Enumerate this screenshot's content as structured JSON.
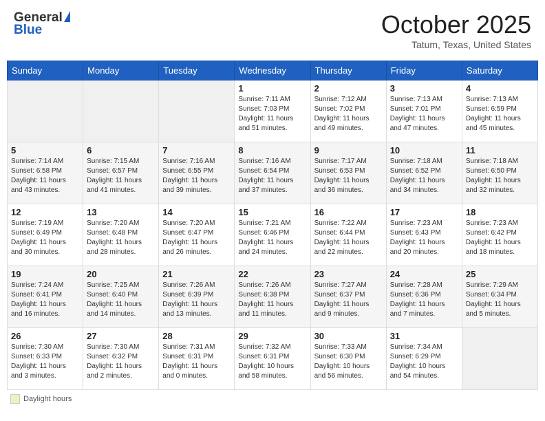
{
  "header": {
    "logo_general": "General",
    "logo_blue": "Blue",
    "month_title": "October 2025",
    "location": "Tatum, Texas, United States"
  },
  "weekdays": [
    "Sunday",
    "Monday",
    "Tuesday",
    "Wednesday",
    "Thursday",
    "Friday",
    "Saturday"
  ],
  "footer": {
    "legend_label": "Daylight hours"
  },
  "weeks": [
    [
      {
        "day": "",
        "sunrise": "",
        "sunset": "",
        "daylight": ""
      },
      {
        "day": "",
        "sunrise": "",
        "sunset": "",
        "daylight": ""
      },
      {
        "day": "",
        "sunrise": "",
        "sunset": "",
        "daylight": ""
      },
      {
        "day": "1",
        "sunrise": "Sunrise: 7:11 AM",
        "sunset": "Sunset: 7:03 PM",
        "daylight": "Daylight: 11 hours and 51 minutes."
      },
      {
        "day": "2",
        "sunrise": "Sunrise: 7:12 AM",
        "sunset": "Sunset: 7:02 PM",
        "daylight": "Daylight: 11 hours and 49 minutes."
      },
      {
        "day": "3",
        "sunrise": "Sunrise: 7:13 AM",
        "sunset": "Sunset: 7:01 PM",
        "daylight": "Daylight: 11 hours and 47 minutes."
      },
      {
        "day": "4",
        "sunrise": "Sunrise: 7:13 AM",
        "sunset": "Sunset: 6:59 PM",
        "daylight": "Daylight: 11 hours and 45 minutes."
      }
    ],
    [
      {
        "day": "5",
        "sunrise": "Sunrise: 7:14 AM",
        "sunset": "Sunset: 6:58 PM",
        "daylight": "Daylight: 11 hours and 43 minutes."
      },
      {
        "day": "6",
        "sunrise": "Sunrise: 7:15 AM",
        "sunset": "Sunset: 6:57 PM",
        "daylight": "Daylight: 11 hours and 41 minutes."
      },
      {
        "day": "7",
        "sunrise": "Sunrise: 7:16 AM",
        "sunset": "Sunset: 6:55 PM",
        "daylight": "Daylight: 11 hours and 39 minutes."
      },
      {
        "day": "8",
        "sunrise": "Sunrise: 7:16 AM",
        "sunset": "Sunset: 6:54 PM",
        "daylight": "Daylight: 11 hours and 37 minutes."
      },
      {
        "day": "9",
        "sunrise": "Sunrise: 7:17 AM",
        "sunset": "Sunset: 6:53 PM",
        "daylight": "Daylight: 11 hours and 36 minutes."
      },
      {
        "day": "10",
        "sunrise": "Sunrise: 7:18 AM",
        "sunset": "Sunset: 6:52 PM",
        "daylight": "Daylight: 11 hours and 34 minutes."
      },
      {
        "day": "11",
        "sunrise": "Sunrise: 7:18 AM",
        "sunset": "Sunset: 6:50 PM",
        "daylight": "Daylight: 11 hours and 32 minutes."
      }
    ],
    [
      {
        "day": "12",
        "sunrise": "Sunrise: 7:19 AM",
        "sunset": "Sunset: 6:49 PM",
        "daylight": "Daylight: 11 hours and 30 minutes."
      },
      {
        "day": "13",
        "sunrise": "Sunrise: 7:20 AM",
        "sunset": "Sunset: 6:48 PM",
        "daylight": "Daylight: 11 hours and 28 minutes."
      },
      {
        "day": "14",
        "sunrise": "Sunrise: 7:20 AM",
        "sunset": "Sunset: 6:47 PM",
        "daylight": "Daylight: 11 hours and 26 minutes."
      },
      {
        "day": "15",
        "sunrise": "Sunrise: 7:21 AM",
        "sunset": "Sunset: 6:46 PM",
        "daylight": "Daylight: 11 hours and 24 minutes."
      },
      {
        "day": "16",
        "sunrise": "Sunrise: 7:22 AM",
        "sunset": "Sunset: 6:44 PM",
        "daylight": "Daylight: 11 hours and 22 minutes."
      },
      {
        "day": "17",
        "sunrise": "Sunrise: 7:23 AM",
        "sunset": "Sunset: 6:43 PM",
        "daylight": "Daylight: 11 hours and 20 minutes."
      },
      {
        "day": "18",
        "sunrise": "Sunrise: 7:23 AM",
        "sunset": "Sunset: 6:42 PM",
        "daylight": "Daylight: 11 hours and 18 minutes."
      }
    ],
    [
      {
        "day": "19",
        "sunrise": "Sunrise: 7:24 AM",
        "sunset": "Sunset: 6:41 PM",
        "daylight": "Daylight: 11 hours and 16 minutes."
      },
      {
        "day": "20",
        "sunrise": "Sunrise: 7:25 AM",
        "sunset": "Sunset: 6:40 PM",
        "daylight": "Daylight: 11 hours and 14 minutes."
      },
      {
        "day": "21",
        "sunrise": "Sunrise: 7:26 AM",
        "sunset": "Sunset: 6:39 PM",
        "daylight": "Daylight: 11 hours and 13 minutes."
      },
      {
        "day": "22",
        "sunrise": "Sunrise: 7:26 AM",
        "sunset": "Sunset: 6:38 PM",
        "daylight": "Daylight: 11 hours and 11 minutes."
      },
      {
        "day": "23",
        "sunrise": "Sunrise: 7:27 AM",
        "sunset": "Sunset: 6:37 PM",
        "daylight": "Daylight: 11 hours and 9 minutes."
      },
      {
        "day": "24",
        "sunrise": "Sunrise: 7:28 AM",
        "sunset": "Sunset: 6:36 PM",
        "daylight": "Daylight: 11 hours and 7 minutes."
      },
      {
        "day": "25",
        "sunrise": "Sunrise: 7:29 AM",
        "sunset": "Sunset: 6:34 PM",
        "daylight": "Daylight: 11 hours and 5 minutes."
      }
    ],
    [
      {
        "day": "26",
        "sunrise": "Sunrise: 7:30 AM",
        "sunset": "Sunset: 6:33 PM",
        "daylight": "Daylight: 11 hours and 3 minutes."
      },
      {
        "day": "27",
        "sunrise": "Sunrise: 7:30 AM",
        "sunset": "Sunset: 6:32 PM",
        "daylight": "Daylight: 11 hours and 2 minutes."
      },
      {
        "day": "28",
        "sunrise": "Sunrise: 7:31 AM",
        "sunset": "Sunset: 6:31 PM",
        "daylight": "Daylight: 11 hours and 0 minutes."
      },
      {
        "day": "29",
        "sunrise": "Sunrise: 7:32 AM",
        "sunset": "Sunset: 6:31 PM",
        "daylight": "Daylight: 10 hours and 58 minutes."
      },
      {
        "day": "30",
        "sunrise": "Sunrise: 7:33 AM",
        "sunset": "Sunset: 6:30 PM",
        "daylight": "Daylight: 10 hours and 56 minutes."
      },
      {
        "day": "31",
        "sunrise": "Sunrise: 7:34 AM",
        "sunset": "Sunset: 6:29 PM",
        "daylight": "Daylight: 10 hours and 54 minutes."
      },
      {
        "day": "",
        "sunrise": "",
        "sunset": "",
        "daylight": ""
      }
    ]
  ]
}
